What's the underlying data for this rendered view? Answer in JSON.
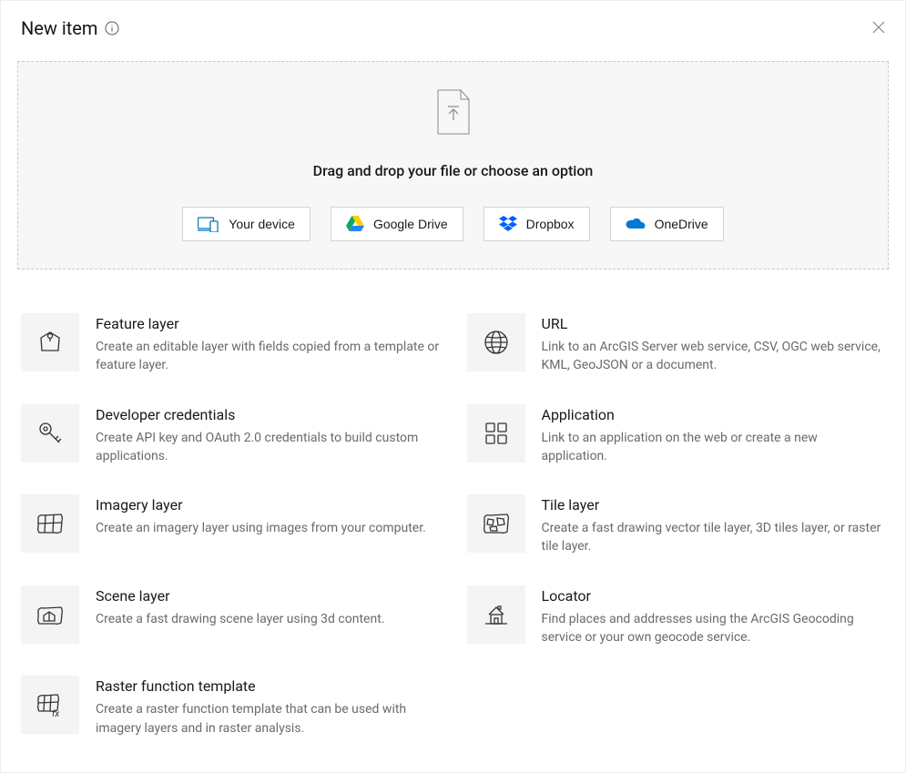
{
  "header": {
    "title": "New item"
  },
  "dropzone": {
    "text": "Drag and drop your file or choose an option",
    "sources": [
      {
        "id": "your-device",
        "label": "Your device"
      },
      {
        "id": "google-drive",
        "label": "Google Drive"
      },
      {
        "id": "dropbox",
        "label": "Dropbox"
      },
      {
        "id": "onedrive",
        "label": "OneDrive"
      }
    ]
  },
  "options": [
    {
      "id": "feature-layer",
      "title": "Feature layer",
      "desc": "Create an editable layer with fields copied from a template or feature layer."
    },
    {
      "id": "url",
      "title": "URL",
      "desc": "Link to an ArcGIS Server web service, CSV, OGC web service, KML, GeoJSON or a document."
    },
    {
      "id": "dev-credentials",
      "title": "Developer credentials",
      "desc": "Create API key and OAuth 2.0 credentials to build custom applications."
    },
    {
      "id": "application",
      "title": "Application",
      "desc": "Link to an application on the web or create a new application."
    },
    {
      "id": "imagery-layer",
      "title": "Imagery layer",
      "desc": "Create an imagery layer using images from your computer."
    },
    {
      "id": "tile-layer",
      "title": "Tile layer",
      "desc": "Create a fast drawing vector tile layer, 3D tiles layer, or raster tile layer."
    },
    {
      "id": "scene-layer",
      "title": "Scene layer",
      "desc": "Create a fast drawing scene layer using 3d content."
    },
    {
      "id": "locator",
      "title": "Locator",
      "desc": "Find places and addresses using the ArcGIS Geocoding service or your own geocode service."
    },
    {
      "id": "raster-template",
      "title": "Raster function template",
      "desc": "Create a raster function template that can be used with imagery layers and in raster analysis."
    }
  ]
}
